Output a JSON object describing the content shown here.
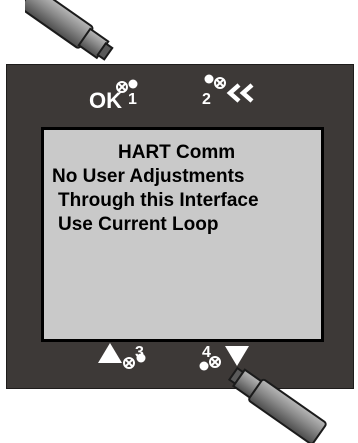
{
  "display": {
    "lines": [
      "HART Comm",
      "No User Adjustments",
      "Through this Interface",
      "Use Current Loop"
    ]
  },
  "buttons": {
    "ok_label": "OK",
    "b1_number": "1",
    "b2_number": "2",
    "b3_number": "3",
    "b4_number": "4"
  },
  "icons": {
    "b2": "double-chevron-left-icon",
    "b3": "triangle-up-icon",
    "b4": "triangle-down-icon"
  },
  "colors": {
    "panel": "#3d3937",
    "lcd": "#c9c9c9",
    "probe": "#7a7a7a"
  }
}
